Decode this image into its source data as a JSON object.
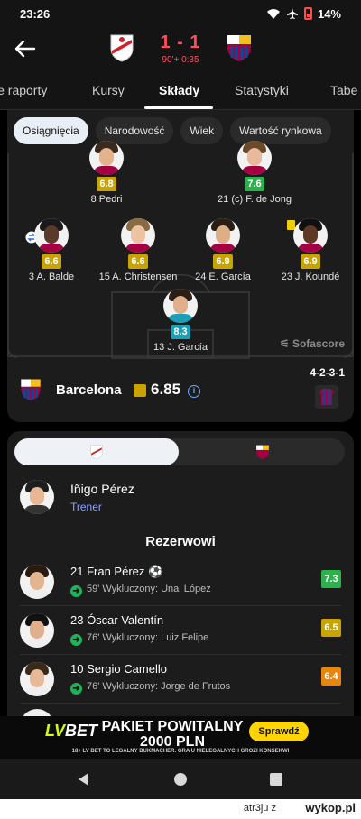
{
  "status_bar": {
    "time": "23:26",
    "battery": "14%"
  },
  "match": {
    "score": "1 - 1",
    "time": "90'+ 0:35"
  },
  "tabs": [
    {
      "label": "ie raporty"
    },
    {
      "label": "Kursy"
    },
    {
      "label": "Składy",
      "active": true
    },
    {
      "label": "Statystyki"
    },
    {
      "label": "Tabe"
    }
  ],
  "filters": [
    {
      "label": "Osiągnięcia",
      "active": true
    },
    {
      "label": "Narodowość"
    },
    {
      "label": "Wiek"
    },
    {
      "label": "Wartość rynkowa"
    }
  ],
  "lineup": {
    "players": [
      {
        "name": "8 Pedri",
        "rating": "6.8",
        "rating_color": "#c9a400"
      },
      {
        "name": "21 (c) F. de Jong",
        "rating": "7.6",
        "rating_color": "#2bb24c"
      },
      {
        "name": "3 A. Balde",
        "rating": "6.6",
        "rating_color": "#c9a400"
      },
      {
        "name": "15 A. Christensen",
        "rating": "6.6",
        "rating_color": "#c9a400"
      },
      {
        "name": "24 E. García",
        "rating": "6.9",
        "rating_color": "#c9a400"
      },
      {
        "name": "23 J. Koundé",
        "rating": "6.9",
        "rating_color": "#c9a400"
      },
      {
        "name": "13 J. García",
        "rating": "8.3",
        "rating_color": "#1a9fb5"
      }
    ],
    "watermark": "Sofascore"
  },
  "team": {
    "name": "Barcelona",
    "rating": "6.85",
    "formation": "4-2-3-1"
  },
  "coach": {
    "name": "Iñigo Pérez",
    "role": "Trener"
  },
  "substitutes": {
    "title": "Rezerwowi",
    "items": [
      {
        "name": "21 Fran Pérez",
        "detail": "59' Wykluczony: Unai López",
        "rating": "7.3",
        "rating_color": "#2bb24c"
      },
      {
        "name": "23 Óscar Valentín",
        "detail": "76' Wykluczony: Luiz Felipe",
        "rating": "6.5",
        "rating_color": "#c9a400"
      },
      {
        "name": "10 Sergio Camello",
        "detail": "76' Wykluczony: Jorge de Frutos",
        "rating": "6.4",
        "rating_color": "#e8860c"
      }
    ]
  },
  "ad": {
    "brand_a": "LV",
    "brand_b": "BET",
    "title_line1": "PAKIET POWITALNY",
    "title_line2": "2000 PLN",
    "button": "Sprawdź",
    "fine_print": "18+ LV BET TO LEGALNY BUKMACHER. GRA U NIELEGALNYCH GROZI KONSEKWI"
  },
  "footer": {
    "user": "atr3ju",
    "sep": "z",
    "site": "wykop.pl"
  }
}
